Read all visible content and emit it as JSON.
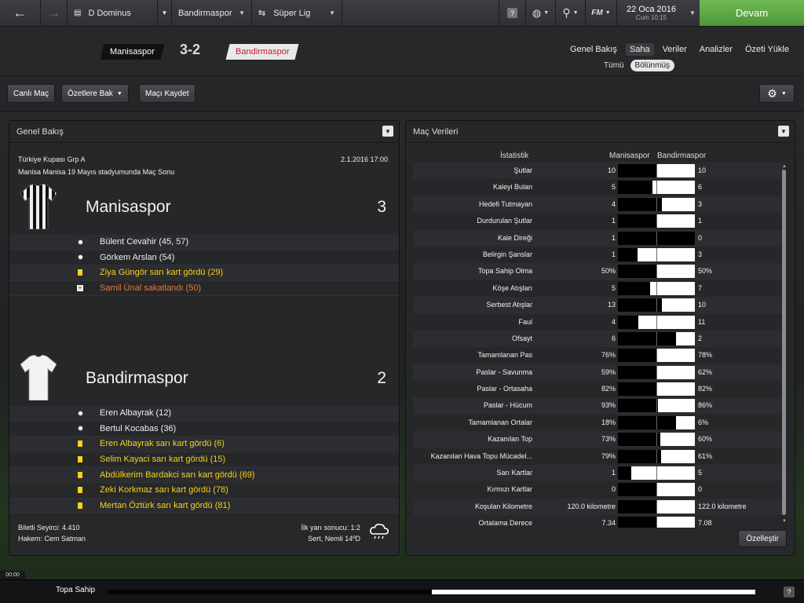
{
  "topbar": {
    "manager": "D Dominus",
    "club": "Bandirmaspor",
    "competition": "Süper Lig",
    "date": "22 Oca 2016",
    "time": "Cum 10:15",
    "continue_label": "Devam",
    "help_label": "?",
    "fm_label": "FM"
  },
  "match": {
    "home": "Manisaspor",
    "away": "Bandirmaspor",
    "score": "3-2",
    "tabs": [
      "Genel Bakış",
      "Saha",
      "Veriler",
      "Analizler",
      "Özeti Yükle"
    ],
    "active_tab": "Saha",
    "subtabs": [
      "Tümü",
      "Bölünmüş"
    ],
    "active_subtab": "Bölünmüş"
  },
  "actions": {
    "live": "Canlı Maç",
    "highlights": "Özetlere Bak",
    "save": "Maçı Kaydet"
  },
  "overview": {
    "title": "Genel Bakış",
    "competition": "Türkiye Kupası Grp A",
    "venue": "Manisa Manisa 19 Mayıs stadyumunda Maç Sonu",
    "datetime": "2.1.2016 17:00",
    "home": {
      "name": "Manisaspor",
      "score": "3",
      "events": [
        {
          "type": "goal",
          "text": "Bülent Cevahir (45, 57)"
        },
        {
          "type": "goal",
          "text": "Görkem Arslan (54)"
        },
        {
          "type": "card",
          "text": "Ziya Güngör sarı kart gördü (29)"
        },
        {
          "type": "injury",
          "text": "Samil Ünal sakatlandı (50)"
        }
      ]
    },
    "away": {
      "name": "Bandirmaspor",
      "score": "2",
      "events": [
        {
          "type": "goal",
          "text": "Eren Albayrak (12)"
        },
        {
          "type": "goal",
          "text": "Bertul Kocabas (36)"
        },
        {
          "type": "card",
          "text": "Eren Albayrak sarı kart gördü (6)"
        },
        {
          "type": "card",
          "text": "Selim Kayaci sarı kart gördü (15)"
        },
        {
          "type": "card",
          "text": "Abdülkerim Bardakci sarı kart gördü (69)"
        },
        {
          "type": "card",
          "text": "Zeki Korkmaz sarı kart gördü (78)"
        },
        {
          "type": "card",
          "text": "Mertan Öztürk sarı kart gördü (81)"
        }
      ]
    },
    "attendance": "Biletli Seyirci: 4.410",
    "referee": "Hakem: Cem Satman",
    "halftime": "İlk yarı sonucu: 1:2",
    "weather": "Sert, Nemli 14ºD"
  },
  "stats": {
    "title": "Maç Verileri",
    "col_stat": "İstatistik",
    "col_home": "Manisaspor",
    "col_away": "Bandirmaspor",
    "customize": "Özelleştir",
    "rows": [
      {
        "label": "Şutlar",
        "home": "10",
        "away": "10",
        "home_share": 0.5
      },
      {
        "label": "Kaleyi Bulan",
        "home": "5",
        "away": "6",
        "home_share": 0.45
      },
      {
        "label": "Hedefi Tutmayan",
        "home": "4",
        "away": "3",
        "home_share": 0.57
      },
      {
        "label": "Durdurulan Şutlar",
        "home": "1",
        "away": "1",
        "home_share": 0.5
      },
      {
        "label": "Kale Direği",
        "home": "1",
        "away": "0",
        "home_share": 1.0
      },
      {
        "label": "Belirgin Şanslar",
        "home": "1",
        "away": "3",
        "home_share": 0.25
      },
      {
        "label": "Topa Sahip Olma",
        "home": "50%",
        "away": "50%",
        "home_share": 0.5
      },
      {
        "label": "Köşe Atışları",
        "home": "5",
        "away": "7",
        "home_share": 0.42
      },
      {
        "label": "Serbest Atışlar",
        "home": "13",
        "away": "10",
        "home_share": 0.57
      },
      {
        "label": "Faul",
        "home": "4",
        "away": "11",
        "home_share": 0.27
      },
      {
        "label": "Ofsayt",
        "home": "6",
        "away": "2",
        "home_share": 0.75
      },
      {
        "label": "Tamamlanan Pas",
        "home": "76%",
        "away": "78%",
        "home_share": 0.5
      },
      {
        "label": "Paslar - Savunma",
        "home": "59%",
        "away": "62%",
        "home_share": 0.5
      },
      {
        "label": "Paslar - Ortasaha",
        "home": "82%",
        "away": "82%",
        "home_share": 0.5
      },
      {
        "label": "Paslar - Hücum",
        "home": "93%",
        "away": "86%",
        "home_share": 0.52
      },
      {
        "label": "Tamamlanan Ortalar",
        "home": "18%",
        "away": "6%",
        "home_share": 0.75
      },
      {
        "label": "Kazanılan Top",
        "home": "73%",
        "away": "60%",
        "home_share": 0.55
      },
      {
        "label": "Kazanılan Hava Topu Mücadel...",
        "home": "79%",
        "away": "61%",
        "home_share": 0.56
      },
      {
        "label": "Sarı Kartlar",
        "home": "1",
        "away": "5",
        "home_share": 0.17
      },
      {
        "label": "Kırmızı Kartlar",
        "home": "0",
        "away": "0",
        "home_share": 0.5
      },
      {
        "label": "Koşulan Kilometre",
        "home": "120.0 kilometre",
        "away": "122.0 kilometre",
        "home_share": 0.5
      },
      {
        "label": "Ortalama Derece",
        "home": "7.34",
        "away": "7.08",
        "home_share": 0.5
      }
    ]
  },
  "bottom": {
    "clock": "00:00",
    "possession_label": "Topa Sahip",
    "possession_home_share": 0.5,
    "help": "?"
  }
}
